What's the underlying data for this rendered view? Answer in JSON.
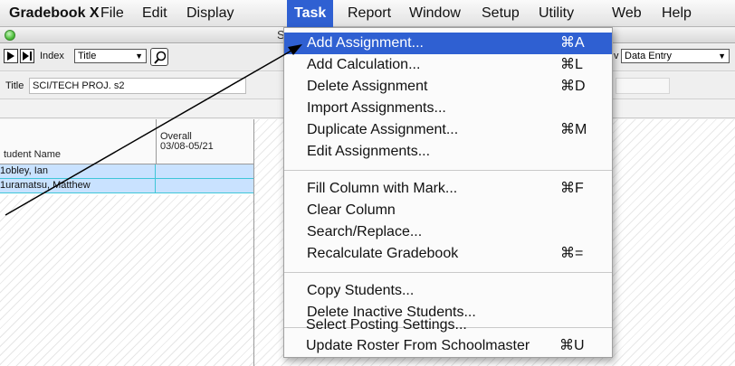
{
  "menubar": {
    "app": "Gradebook X",
    "items": [
      "File",
      "Edit",
      "Display",
      "Task",
      "Report",
      "Window",
      "Setup",
      "Utility",
      "Web",
      "Help"
    ],
    "active": "Task"
  },
  "window": {
    "title_fragment": "S",
    "toolbar": {
      "index_label": "Index",
      "index_value": "Title",
      "view_value": "Data Entry",
      "view_label_fragment": "v"
    },
    "filter": {
      "label": "Title",
      "value": "SCI/TECH PROJ. s2"
    },
    "grid": {
      "columns": [
        {
          "label": "tudent Name"
        },
        {
          "label": "Overall",
          "sub": "03/08-05/21"
        }
      ],
      "rows": [
        {
          "name": "1obley, Ian",
          "overall": ""
        },
        {
          "name": "1uramatsu, Matthew",
          "overall": ""
        }
      ]
    }
  },
  "task_menu": {
    "groups": [
      [
        {
          "label": "Add Assignment...",
          "shortcut": "⌘A",
          "highlighted": true
        },
        {
          "label": "Add Calculation...",
          "shortcut": "⌘L"
        },
        {
          "label": "Delete Assignment",
          "shortcut": "⌘D"
        },
        {
          "label": "Import Assignments...",
          "shortcut": ""
        },
        {
          "label": "Duplicate Assignment...",
          "shortcut": "⌘M"
        },
        {
          "label": "Edit Assignments...",
          "shortcut": ""
        }
      ],
      [
        {
          "label": "Fill Column with Mark...",
          "shortcut": "⌘F"
        },
        {
          "label": "Clear Column",
          "shortcut": ""
        },
        {
          "label": "Search/Replace...",
          "shortcut": ""
        },
        {
          "label": "Recalculate Gradebook",
          "shortcut": "⌘="
        }
      ],
      [
        {
          "label": "Copy Students...",
          "shortcut": ""
        },
        {
          "label": "Delete Inactive Students...",
          "shortcut": ""
        }
      ],
      [
        {
          "label": "Select Posting Settings...",
          "shortcut": ""
        },
        {
          "label": "Update Roster From Schoolmaster",
          "shortcut": "⌘U"
        }
      ]
    ]
  },
  "colors": {
    "highlight": "#2f60d2",
    "row_selected": "#c9e2ff",
    "row_border": "#3ec6d8"
  }
}
